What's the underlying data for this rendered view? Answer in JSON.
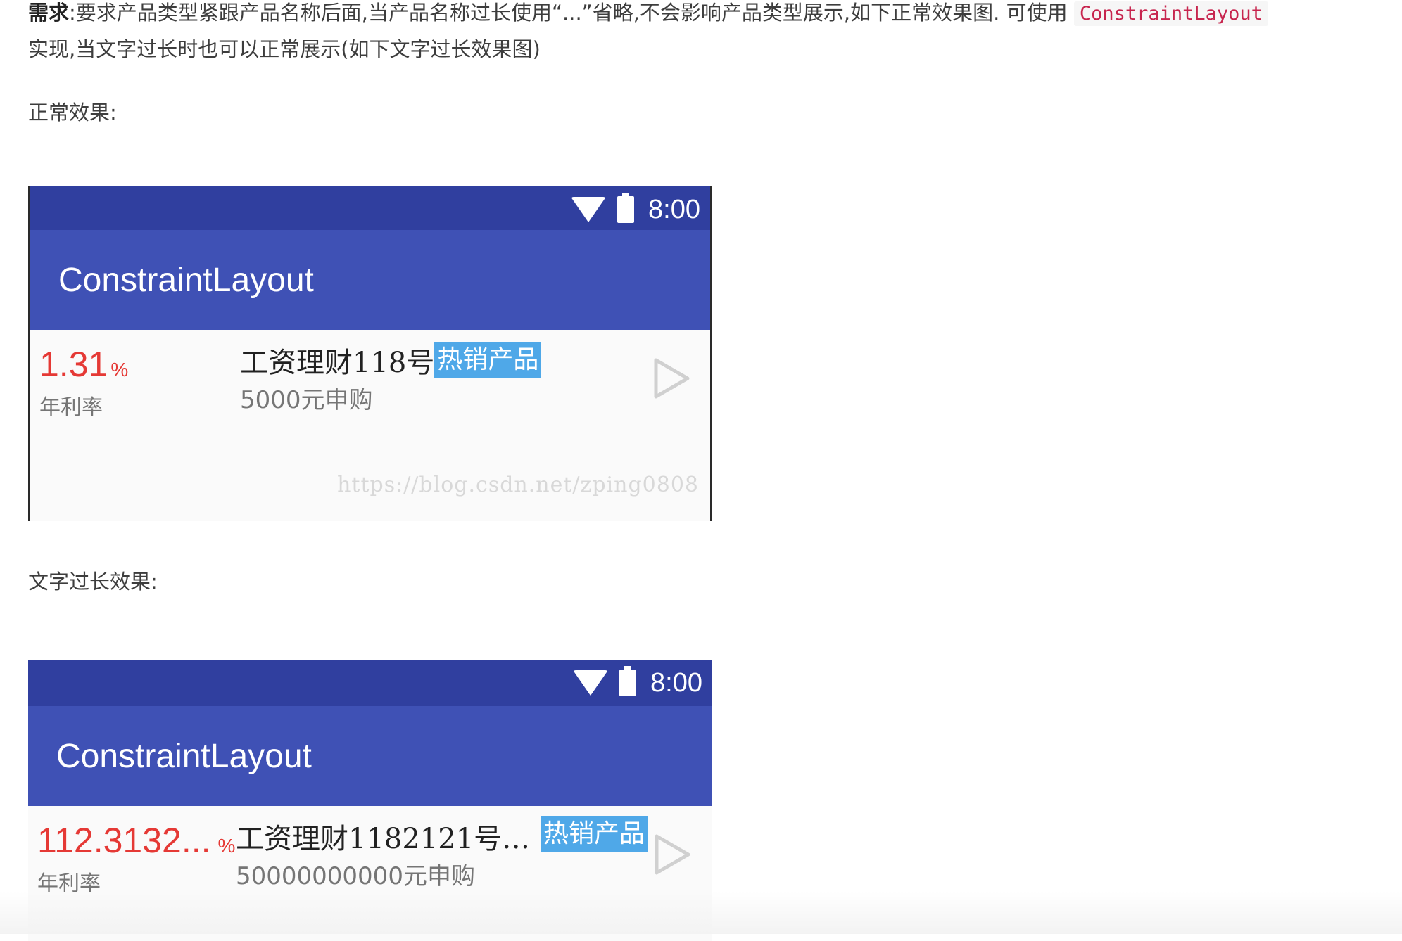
{
  "article": {
    "req_label": "需求",
    "req_text1": ":要求产品类型紧跟产品名称后面,当产品名称过长使用“...”省略,不会影响产品类型展示,如下正常效果图. 可使用 ",
    "req_code": "ConstraintLayout",
    "req_text2": "实现,当文字过长时也可以正常展示(如下文字过长效果图)",
    "normal_label": "正常效果:",
    "long_label": "文字过长效果:"
  },
  "screenshots": [
    {
      "status_time": "8:00",
      "app_title": "ConstraintLayout",
      "rate_value": "1.31",
      "rate_unit": "%",
      "rate_label": "年利率",
      "product_name": "工资理财118号",
      "product_tag": "热销产品",
      "amount_text": "5000元申购",
      "watermark": "https://blog.csdn.net/zping0808"
    },
    {
      "status_time": "8:00",
      "app_title": "ConstraintLayout",
      "rate_value": "112.3132...",
      "rate_unit": "%",
      "rate_label": "年利率",
      "product_name": "工资理财1182121号…",
      "product_tag": "热销产品",
      "amount_text": "50000000000元申购"
    }
  ],
  "colors": {
    "status_bar": "#303f9f",
    "app_bar": "#3f51b5",
    "rate": "#e53935",
    "tag": "#4fa8e8"
  },
  "icons": [
    "wifi-icon",
    "battery-icon",
    "play-arrow-icon"
  ]
}
